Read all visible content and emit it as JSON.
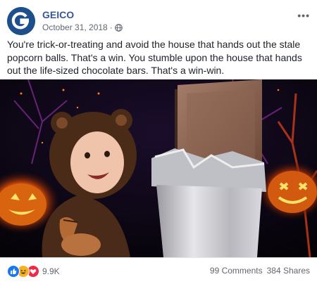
{
  "post": {
    "author": "GEICO",
    "date": "October 31, 2018",
    "date_separator": "·",
    "more_label": "•••",
    "text": "You're trick-or-treating and avoid the house that hands out the stale popcorn balls. That's a win. You stumble upon the house that hands out the life-sized chocolate bars. That's a win-win.",
    "reactions_count": "9.9K",
    "comments": "99 Comments",
    "shares": "384 Shares",
    "reaction_icons": [
      "like-icon",
      "haha-icon",
      "love-icon"
    ],
    "colors": {
      "brand": "#1c4f8c",
      "author": "#365899",
      "like": "#1877f2",
      "haha": "#f7b125",
      "love": "#f0284a"
    }
  }
}
